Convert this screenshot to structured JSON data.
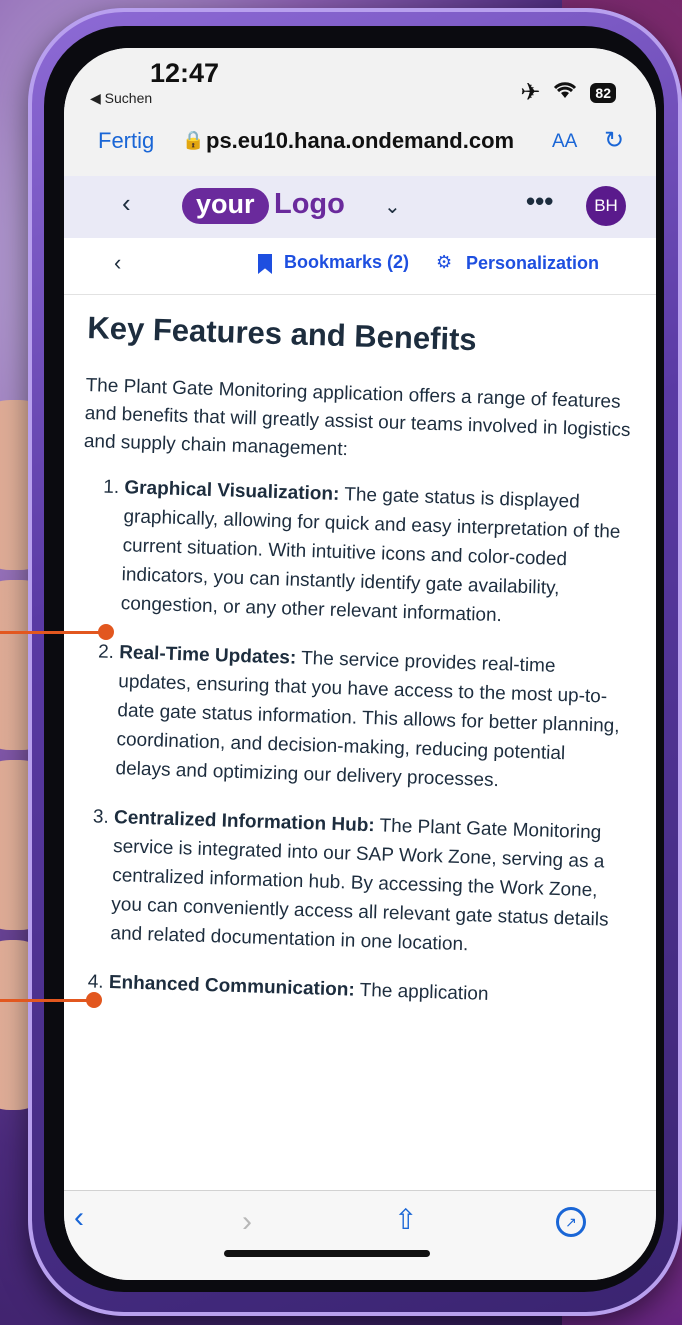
{
  "status": {
    "time": "12:47",
    "back_app": "◀ Suchen",
    "battery": "82"
  },
  "browser": {
    "done": "Fertig",
    "url": "ps.eu10.hana.ondemand.com",
    "aa": "AA"
  },
  "app_header": {
    "logo_pill": "your",
    "logo_text": "Logo",
    "avatar": "BH"
  },
  "sub_bar": {
    "bookmarks": "Bookmarks (2)",
    "personalization": "Personalization"
  },
  "content": {
    "title": "Key Features and Benefits",
    "intro": "The Plant Gate Monitoring application offers a range of features and benefits that will greatly assist our teams involved in logistics and supply chain management:",
    "features": [
      {
        "title": "Graphical Visualization:",
        "text": " The gate status is displayed graphically, allowing for quick and easy interpretation of the current situation. With intuitive icons and color-coded indicators, you can instantly identify gate availability, congestion, or any other relevant information."
      },
      {
        "title": "Real-Time Updates:",
        "text": " The service provides real-time updates, ensuring that you have access to the most up-to-date gate status information. This allows for better planning, coordination, and decision-making, reducing potential delays and optimizing our delivery processes."
      },
      {
        "title": "Centralized Information Hub:",
        "text": " The Plant Gate Monitoring service is integrated into our SAP Work Zone, serving as a centralized information hub. By accessing the Work Zone, you can conveniently access all relevant gate status details and related documentation in one location."
      },
      {
        "title": "Enhanced Communication:",
        "text": " The application"
      }
    ]
  },
  "colors": {
    "link": "#1a66d6",
    "brand": "#6a2a9c",
    "sap_blue": "#1e4fe0",
    "callout": "#e2571f"
  }
}
